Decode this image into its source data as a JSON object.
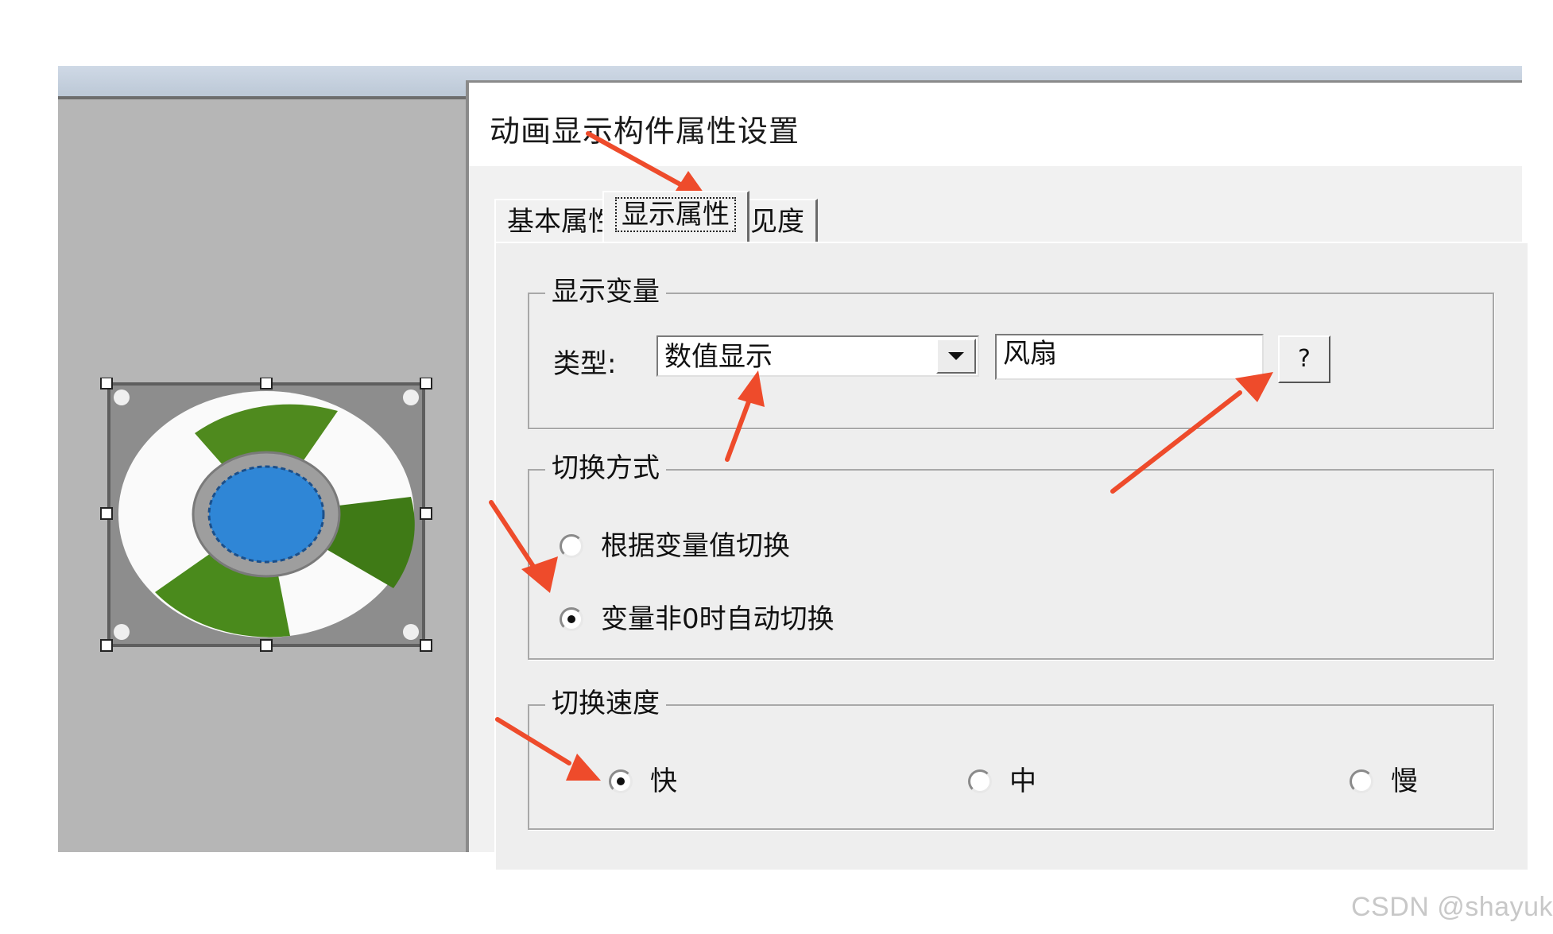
{
  "dialog": {
    "title": "动画显示构件属性设置",
    "tabs": [
      {
        "label": "基本属性",
        "active": false
      },
      {
        "label": "显示属性",
        "active": true
      },
      {
        "label": "可见度",
        "active": false
      }
    ]
  },
  "display_variable": {
    "legend": "显示变量",
    "type_label": "类型:",
    "type_value": "数值显示",
    "variable_value": "风扇",
    "help_button_label": "?"
  },
  "switch_mode": {
    "legend": "切换方式",
    "options": [
      {
        "label": "根据变量值切换",
        "selected": false
      },
      {
        "label": "变量非0时自动切换",
        "selected": true
      }
    ]
  },
  "switch_speed": {
    "legend": "切换速度",
    "options": [
      {
        "label": "快",
        "selected": true
      },
      {
        "label": "中",
        "selected": false
      },
      {
        "label": "慢",
        "selected": false
      }
    ]
  },
  "canvas": {
    "object_icon": "fan-icon"
  },
  "colors": {
    "annotation_arrow": "#ee4b2b",
    "dialog_bg": "#f1f1f1",
    "canvas_bg": "#b6b6b6",
    "fan_green": "#4f8a1e",
    "fan_blue": "#2f86d6"
  },
  "watermark": "CSDN @shayuk"
}
